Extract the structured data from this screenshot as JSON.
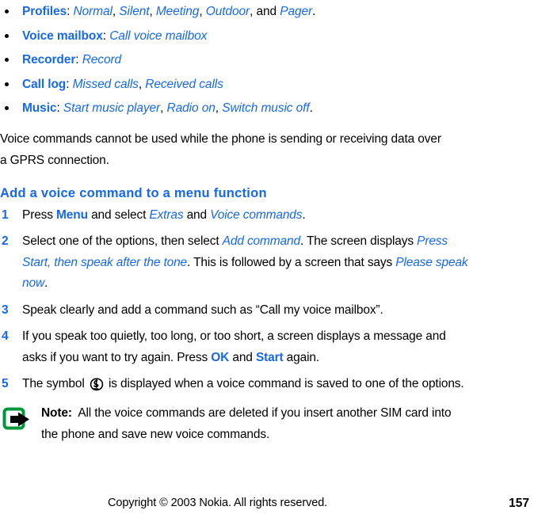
{
  "document": {
    "bullets": [
      {
        "term": "Profiles",
        "colon": ":",
        "values_markup": [
          {
            "text": "Normal",
            "style": "blue-italic"
          },
          {
            "text": ", ",
            "style": "plain"
          },
          {
            "text": "Silent",
            "style": "blue-italic"
          },
          {
            "text": ", ",
            "style": "plain"
          },
          {
            "text": "Meeting",
            "style": "blue-italic"
          },
          {
            "text": ", ",
            "style": "plain"
          },
          {
            "text": "Outdoor",
            "style": "blue-italic"
          },
          {
            "text": ", and ",
            "style": "plain"
          },
          {
            "text": "Pager",
            "style": "blue-italic"
          },
          {
            "text": ".",
            "style": "plain"
          }
        ],
        "plain": "Profiles: Normal, Silent, Meeting, Outdoor, and Pager."
      },
      {
        "term": "Voice mailbox",
        "colon": ":",
        "values_markup": [
          {
            "text": "Call voice mailbox",
            "style": "blue-italic"
          }
        ],
        "plain": "Voice mailbox: Call voice mailbox"
      },
      {
        "term": "Recorder",
        "colon": ":",
        "values_markup": [
          {
            "text": "Record",
            "style": "blue-italic"
          }
        ],
        "plain": "Recorder: Record"
      },
      {
        "term": "Call log",
        "colon": ":",
        "values_markup": [
          {
            "text": "Missed calls",
            "style": "blue-italic"
          },
          {
            "text": ", ",
            "style": "plain"
          },
          {
            "text": "Received calls",
            "style": "blue-italic"
          }
        ],
        "plain": "Call log: Missed calls, Received calls"
      },
      {
        "term": "Music",
        "colon": ":",
        "values_markup": [
          {
            "text": "Start music player",
            "style": "blue-italic"
          },
          {
            "text": ", ",
            "style": "plain"
          },
          {
            "text": "Radio on",
            "style": "blue-italic"
          },
          {
            "text": ", ",
            "style": "plain"
          },
          {
            "text": "Switch music off",
            "style": "blue-italic"
          },
          {
            "text": ".",
            "style": "plain"
          }
        ],
        "plain": "Music: Start music player, Radio on, Switch music off."
      }
    ],
    "intro_paragraph": "Voice commands cannot be used while the phone is sending or receiving data over a GPRS connection.",
    "section_heading": "Add a voice command to a menu function",
    "steps": [
      {
        "number": "1",
        "parts": [
          {
            "text": "Press ",
            "style": "plain"
          },
          {
            "text": "Menu",
            "style": "blue-bold"
          },
          {
            "text": " and select ",
            "style": "plain"
          },
          {
            "text": "Extras",
            "style": "blue-italic"
          },
          {
            "text": " and ",
            "style": "plain"
          },
          {
            "text": "Voice commands",
            "style": "blue-italic"
          },
          {
            "text": ".",
            "style": "plain"
          }
        ],
        "plain": "Press Menu and select Extras and Voice commands."
      },
      {
        "number": "2",
        "parts": [
          {
            "text": "Select one of the options, then select ",
            "style": "plain"
          },
          {
            "text": "Add command",
            "style": "blue-italic"
          },
          {
            "text": ". The screen displays ",
            "style": "plain"
          },
          {
            "text": "Press Start, then speak after the tone",
            "style": "blue-italic"
          },
          {
            "text": ". This is followed by a screen that says ",
            "style": "plain"
          },
          {
            "text": "Please speak now",
            "style": "blue-italic"
          },
          {
            "text": ".",
            "style": "plain"
          }
        ],
        "plain": "Select one of the options, then select Add command. The screen displays Press Start, then speak after the tone. This is followed by a screen that says Please speak now."
      },
      {
        "number": "3",
        "parts": [
          {
            "text": "Speak clearly and add a command such as “Call my voice mailbox”.",
            "style": "plain"
          }
        ],
        "plain": "Speak clearly and add a command such as “Call my voice mailbox”."
      },
      {
        "number": "4",
        "parts": [
          {
            "text": "If you speak too quietly, too long, or too short, a screen displays a message and asks if you want to try again. Press ",
            "style": "plain"
          },
          {
            "text": "OK",
            "style": "blue-bold"
          },
          {
            "text": " and ",
            "style": "plain"
          },
          {
            "text": "Start",
            "style": "blue-bold"
          },
          {
            "text": " again.",
            "style": "plain"
          }
        ],
        "plain": "If you speak too quietly, too long, or too short, a screen displays a message and asks if you want to try again. Press OK and Start again."
      },
      {
        "number": "5",
        "parts": [
          {
            "text": "The symbol ",
            "style": "plain"
          },
          {
            "text": "",
            "style": "voice-tag-icon"
          },
          {
            "text": " is displayed when a voice command is saved to one of the options.",
            "style": "plain"
          }
        ],
        "plain": "The symbol [voice-tag-icon] is displayed when a voice command is saved to one of the options."
      }
    ],
    "note": {
      "label": "Note:",
      "text": "All the voice commands are deleted if you insert another SIM card into the phone and save new voice commands.",
      "icon_name": "note-arrow-icon"
    },
    "footer": {
      "copyright": "Copyright © 2003 Nokia. All rights reserved.",
      "page_number": "157"
    },
    "colors": {
      "accent_blue": "#1668ec",
      "text_black": "#000000",
      "note_icon_green": "#00973a",
      "background": "#ffffff"
    }
  }
}
